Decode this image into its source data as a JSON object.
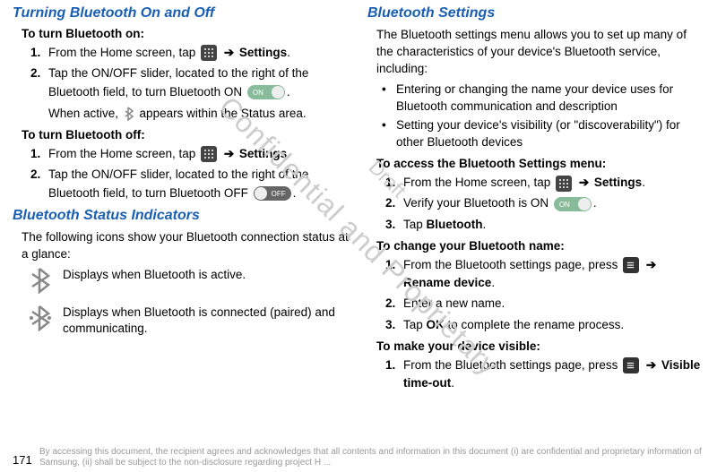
{
  "watermark": {
    "main": "Confidential and Proprietary",
    "draft": "Draft"
  },
  "left": {
    "section1_title": "Turning Bluetooth On and Off",
    "turn_on_title": "To turn Bluetooth on:",
    "turn_on_steps": [
      {
        "num": "1.",
        "text_parts": [
          "From the Home screen, tap ",
          " ",
          " ",
          "Settings",
          "."
        ]
      },
      {
        "num": "2.",
        "text_parts": [
          "Tap the ON/OFF slider, located to the right of the Bluetooth field, to turn Bluetooth ON ",
          "."
        ]
      }
    ],
    "when_active": "When active,   appears within the Status area.",
    "turn_off_title": "To turn Bluetooth off:",
    "turn_off_steps": [
      {
        "num": "1.",
        "text_parts": [
          "From the Home screen, tap ",
          " ",
          " ",
          "Settings",
          "."
        ]
      },
      {
        "num": "2.",
        "text_parts": [
          "Tap the ON/OFF slider, located to the right of the Bluetooth field, to turn Bluetooth OFF ",
          "."
        ]
      }
    ],
    "section2_title": "Bluetooth Status Indicators",
    "status_intro": "The following icons show your Bluetooth connection status at a glance:",
    "status_active": "Displays when Bluetooth is active.",
    "status_connected": "Displays when Bluetooth is connected (paired) and communicating."
  },
  "right": {
    "section_title": "Bluetooth Settings",
    "intro": "The Bluetooth settings menu allows you to set up many of the characteristics of your device's Bluetooth service, including:",
    "bullets": [
      "Entering or changing the name your device uses for Bluetooth communication and description",
      "Setting your device's visibility (or \"discoverability\") for other Bluetooth devices"
    ],
    "access_title": "To access the Bluetooth Settings menu:",
    "access_steps": [
      {
        "num": "1.",
        "prefix": "From the Home screen, tap ",
        "suffix_bold": "Settings",
        "suffix": "."
      },
      {
        "num": "2.",
        "prefix": "Verify your Bluetooth is ON ",
        "suffix": "."
      },
      {
        "num": "3.",
        "prefix": "Tap ",
        "bold": "Bluetooth",
        "suffix": "."
      }
    ],
    "rename_title": "To change your Bluetooth name:",
    "rename_steps": [
      {
        "num": "1.",
        "prefix": "From the Bluetooth settings page, press ",
        "bold": "Rename device",
        "suffix": "."
      },
      {
        "num": "2.",
        "text": "Enter a new name."
      },
      {
        "num": "3.",
        "prefix": "Tap ",
        "bold": "OK",
        "suffix": " to complete the rename process."
      }
    ],
    "visible_title": "To make your device visible:",
    "visible_steps": [
      {
        "num": "1.",
        "prefix": "From the Bluetooth settings page, press ",
        "bold": "Visible time-out",
        "suffix": "."
      }
    ]
  },
  "page_number": "171",
  "disclaimer": "By accessing this document, the recipient agrees and acknowledges that all contents and information in this document (i) are confidential and proprietary information of Samsung, (ii) shall be subject to the non-disclosure regarding project H ..."
}
